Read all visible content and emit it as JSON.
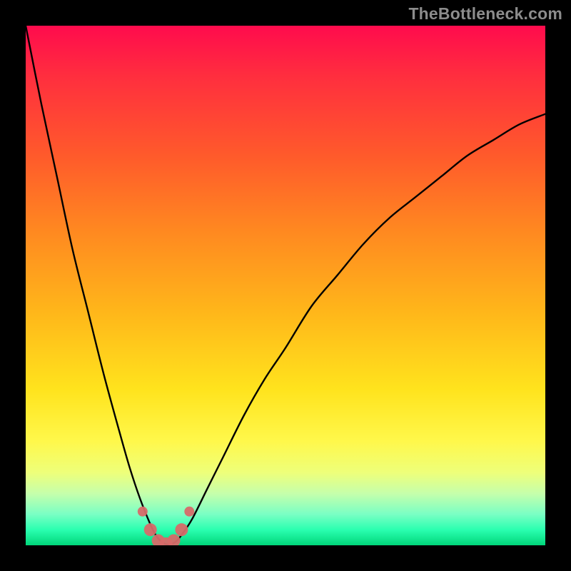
{
  "watermark": "TheBottleneck.com",
  "colors": {
    "frame": "#000000",
    "curve": "#000000",
    "markers": "#d76a69",
    "gradient_top": "#ff0b4d",
    "gradient_bottom": "#00d67a"
  },
  "chart_data": {
    "type": "line",
    "title": "",
    "xlabel": "",
    "ylabel": "",
    "xlim": [
      0,
      100
    ],
    "ylim": [
      0,
      100
    ],
    "grid": false,
    "legend": false,
    "series": [
      {
        "name": "bottleneck-curve",
        "x": [
          0,
          3,
          6,
          9,
          12,
          15,
          18,
          20,
          22,
          24,
          25,
          26,
          27,
          28,
          29,
          30,
          32,
          35,
          38,
          42,
          46,
          50,
          55,
          60,
          65,
          70,
          75,
          80,
          85,
          90,
          95,
          100
        ],
        "y": [
          100,
          85,
          71,
          57,
          45,
          33,
          22,
          15,
          9,
          4,
          2,
          0.8,
          0.2,
          0.2,
          0.8,
          2,
          5,
          11,
          17,
          25,
          32,
          38,
          46,
          52,
          58,
          63,
          67,
          71,
          75,
          78,
          81,
          83
        ]
      }
    ],
    "markers": {
      "name": "highlighted-points",
      "x": [
        22.5,
        24,
        25.5,
        27,
        28.5,
        30,
        31.5
      ],
      "y": [
        6.5,
        3,
        0.9,
        0.3,
        0.9,
        3,
        6.5
      ]
    },
    "notch_x": 27
  }
}
